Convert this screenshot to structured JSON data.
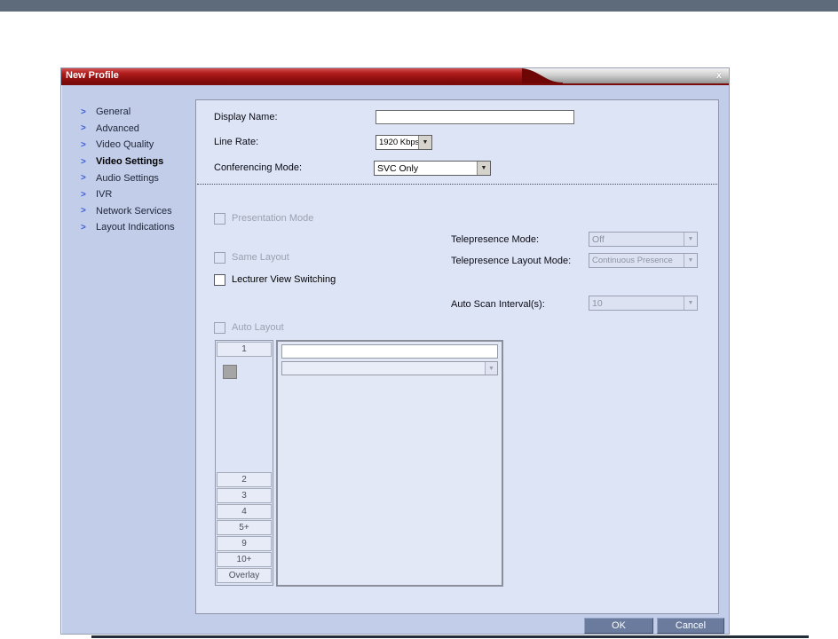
{
  "window": {
    "title": "New Profile",
    "close_glyph": "x"
  },
  "icons": {
    "nav_arrow": ">",
    "dropdown_arrow": "▼"
  },
  "sidebar": {
    "items": [
      {
        "label": "General",
        "active": false
      },
      {
        "label": "Advanced",
        "active": false
      },
      {
        "label": "Video Quality",
        "active": false
      },
      {
        "label": "Video Settings",
        "active": true
      },
      {
        "label": "Audio Settings",
        "active": false
      },
      {
        "label": "IVR",
        "active": false
      },
      {
        "label": "Network Services",
        "active": false
      },
      {
        "label": "Layout Indications",
        "active": false
      }
    ]
  },
  "form": {
    "display_name": {
      "label": "Display Name:",
      "value": ""
    },
    "line_rate": {
      "label": "Line Rate:",
      "value": "1920 Kbps"
    },
    "conferencing_mode": {
      "label": "Conferencing Mode:",
      "value": "SVC Only"
    }
  },
  "options": {
    "presentation_mode": {
      "label": "Presentation Mode",
      "checked": false,
      "enabled": false
    },
    "same_layout": {
      "label": "Same Layout",
      "checked": false,
      "enabled": false
    },
    "lecturer_view_switching": {
      "label": "Lecturer View Switching",
      "checked": false,
      "enabled": true
    },
    "auto_layout": {
      "label": "Auto Layout",
      "checked": false,
      "enabled": false
    },
    "telepresence_mode": {
      "label": "Telepresence Mode:",
      "value": "Off",
      "enabled": false
    },
    "telepresence_layout_mode": {
      "label": "Telepresence Layout Mode:",
      "value": "Continuous Presence",
      "enabled": false
    },
    "auto_scan_interval": {
      "label": "Auto Scan Interval(s):",
      "value": "10",
      "enabled": false
    }
  },
  "layout_selector": {
    "buttons": [
      "1",
      "2",
      "3",
      "4",
      "5+",
      "9",
      "10+",
      "Overlay"
    ],
    "selected": "1"
  },
  "footer": {
    "ok_label": "OK",
    "cancel_label": "Cancel"
  },
  "colors": {
    "title_bar_red": "#931010",
    "dialog_bg": "#c2cee9",
    "panel_bg": "#dde4f5",
    "action_button_bg": "#6a7b9d",
    "top_bar": "#5d6b7a",
    "nav_arrow_blue": "#3a5bd9"
  }
}
